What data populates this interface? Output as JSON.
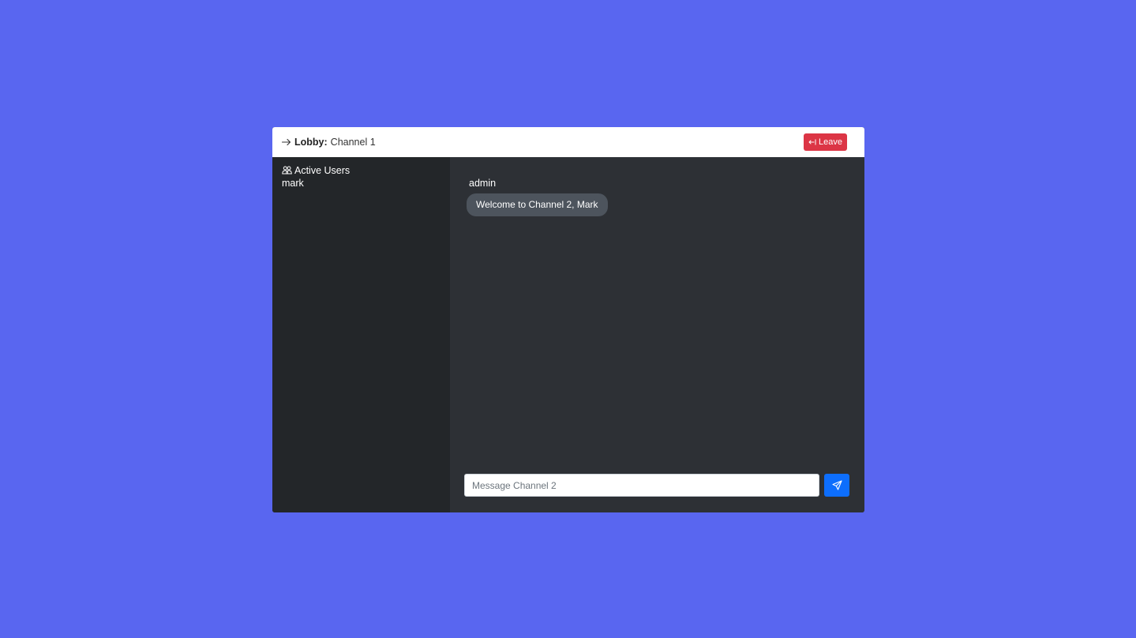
{
  "header": {
    "lobby_label": "Lobby:",
    "channel_name": "Channel 1",
    "leave_label": "Leave",
    "arrow_icon": "arrow-right-icon",
    "leave_icon": "box-arrow-left-icon"
  },
  "sidebar": {
    "title": "Active Users",
    "title_icon": "people-icon",
    "users": [
      "mark"
    ]
  },
  "messages": [
    {
      "author": "admin",
      "text": "Welcome to Channel 2, Mark"
    }
  ],
  "composer": {
    "placeholder": "Message Channel 2",
    "value": "",
    "send_icon": "send-icon"
  },
  "colors": {
    "background": "#5966f0",
    "sidebar": "#232629",
    "main": "#2d3035",
    "bubble": "#4d545d",
    "leave": "#dc3545",
    "send": "#0d6efd"
  }
}
